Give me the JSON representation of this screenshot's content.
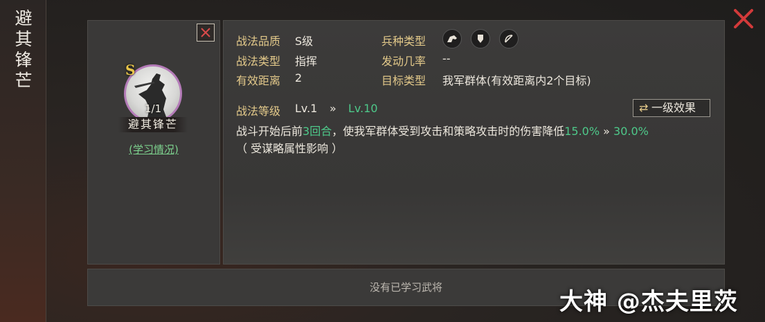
{
  "side": {
    "title_chars": [
      "避",
      "其",
      "锋",
      "芒"
    ]
  },
  "card": {
    "grade": "S",
    "count": "1/1",
    "name": "避其锋芒",
    "study_link": "(学习情况)"
  },
  "info": {
    "quality_label": "战法品质",
    "quality_value": "S级",
    "type_label": "战法类型",
    "type_value": "指挥",
    "range_label": "有效距离",
    "range_value": "2",
    "troop_label": "兵种类型",
    "troop_icons": [
      "cavalry-icon",
      "shield-icon",
      "bow-icon"
    ],
    "rate_label": "发动几率",
    "rate_value": "--",
    "target_label": "目标类型",
    "target_value": "我军群体(有效距离内2个目标)"
  },
  "level": {
    "label": "战法等级",
    "from": "Lv.1",
    "arrow": "»",
    "to": "Lv.10",
    "effect_button": "一级效果"
  },
  "description": {
    "part1": "战斗开始后前",
    "rounds": "3回合",
    "part2": "，使我军群体受到攻击和策略攻击时的伤害降低",
    "pct_from": "15.0%",
    "arrow": "»",
    "pct_to": "30.0%",
    "line2": "（ 受谋略属性影响 ）"
  },
  "bottom": {
    "text": "没有已学习武将"
  },
  "watermark": {
    "text": "大神 @杰夫里茨"
  },
  "colors": {
    "accent_gold": "#e3c98a",
    "accent_green": "#4ec98a",
    "close_red": "#d23a3a"
  }
}
